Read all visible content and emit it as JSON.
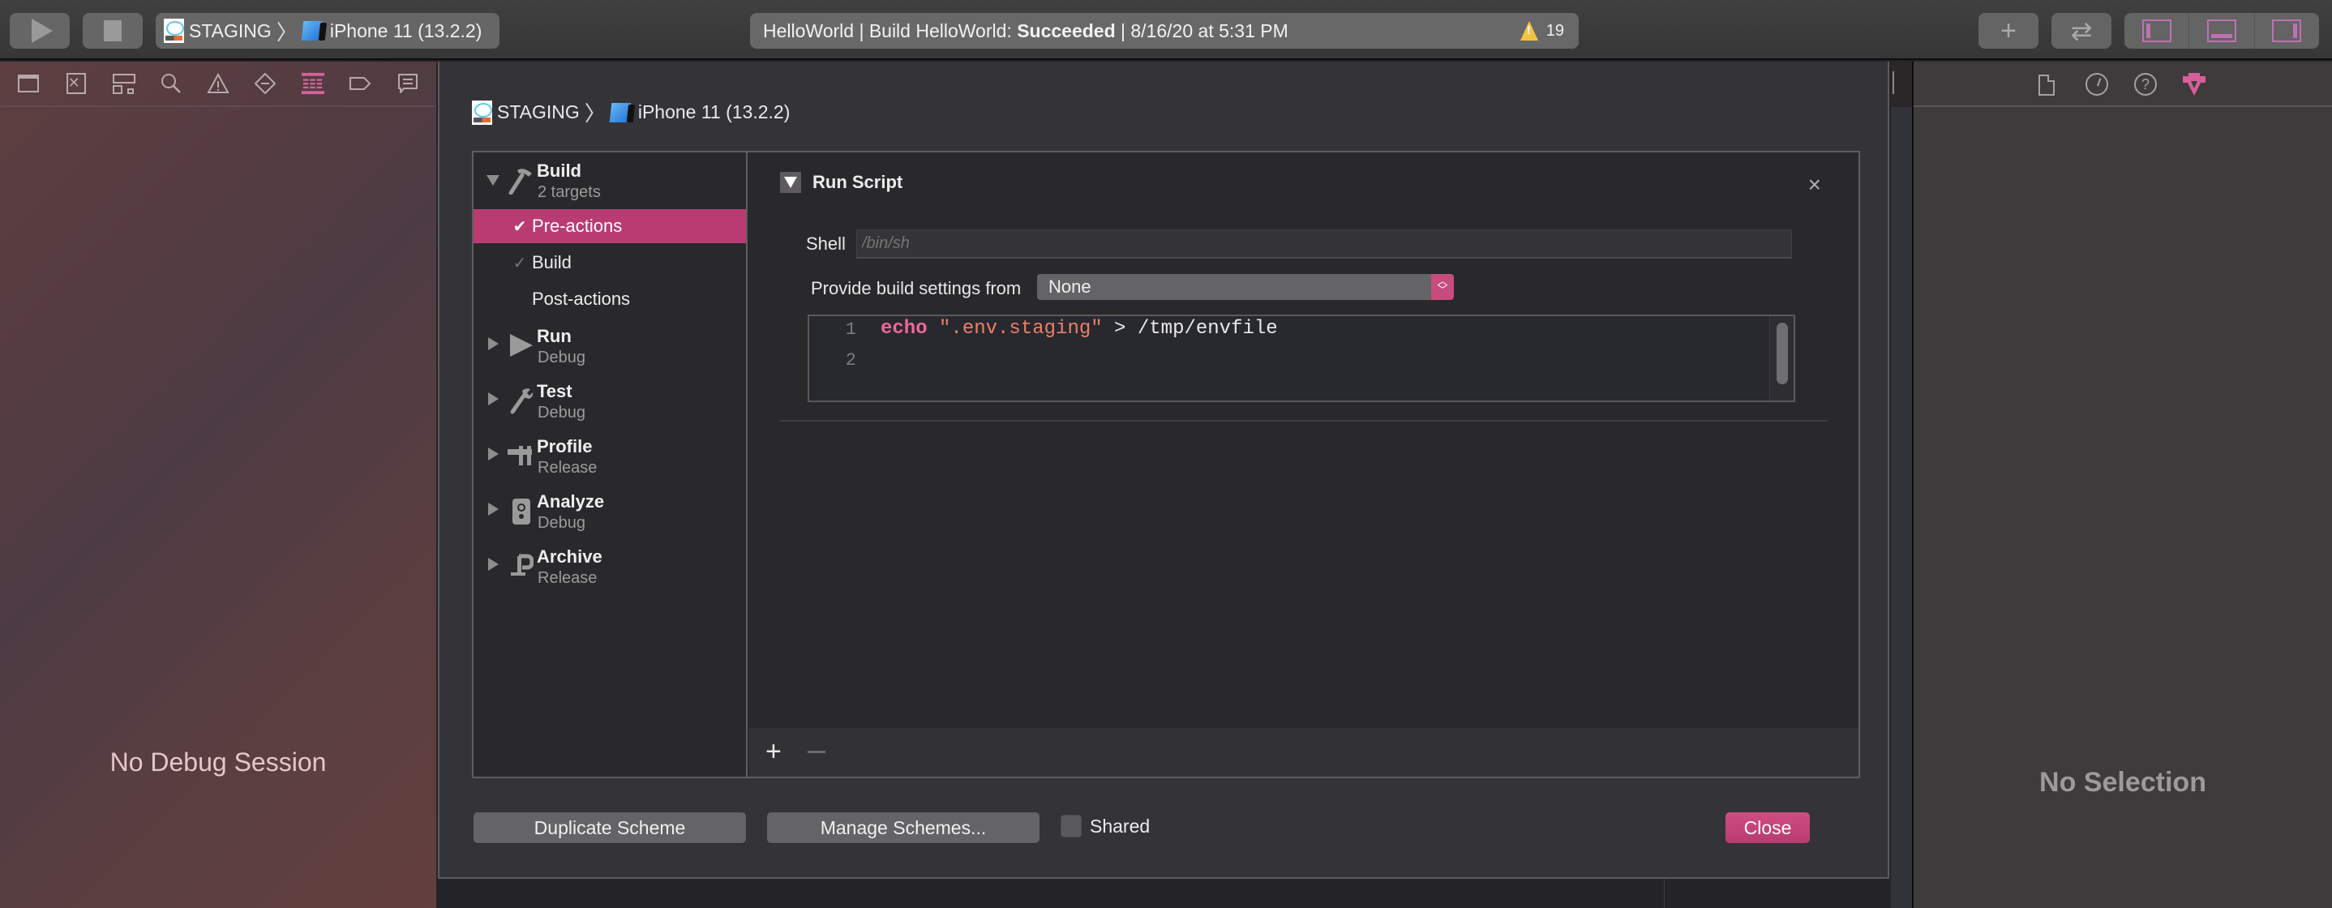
{
  "toolbar": {
    "run_button": "run",
    "stop_button": "stop",
    "scheme": {
      "name": "STAGING",
      "separator": "〉",
      "destination": "iPhone 11 (13.2.2)"
    },
    "status": {
      "prefix": "HelloWorld | Build HelloWorld: ",
      "result": "Succeeded",
      "suffix": " | 8/16/20 at 5:31 PM",
      "warning_count": "19"
    },
    "add_icon": "+",
    "swap_icon": "⇄",
    "panel_toggles": [
      "navigator",
      "debug-area",
      "inspector"
    ],
    "accent_color": "#c071b2"
  },
  "navigator": {
    "icons": [
      "folder-icon",
      "source-control-icon",
      "hierarchy-icon",
      "search-icon",
      "warning-icon",
      "test-icon",
      "debug-icon",
      "breakpoint-icon",
      "report-icon"
    ],
    "active_icon": "debug-icon",
    "empty_message": "No Debug Session"
  },
  "sheet": {
    "breadcrumb": {
      "scheme": "STAGING",
      "separator": "〉",
      "destination": "iPhone 11 (13.2.2)"
    },
    "sidebar": {
      "groups": [
        {
          "name": "Build",
          "subtitle": "2 targets",
          "expanded": true,
          "icon": "hammer-icon",
          "actions": [
            {
              "label": "Pre-actions",
              "checked": true,
              "selected": true
            },
            {
              "label": "Build",
              "checked": true,
              "selected": false
            },
            {
              "label": "Post-actions",
              "checked": false,
              "selected": false
            }
          ]
        },
        {
          "name": "Run",
          "subtitle": "Debug",
          "expanded": false,
          "icon": "play-icon"
        },
        {
          "name": "Test",
          "subtitle": "Debug",
          "expanded": false,
          "icon": "wrench-icon"
        },
        {
          "name": "Profile",
          "subtitle": "Release",
          "expanded": false,
          "icon": "caliper-icon"
        },
        {
          "name": "Analyze",
          "subtitle": "Debug",
          "expanded": false,
          "icon": "analyze-icon"
        },
        {
          "name": "Archive",
          "subtitle": "Release",
          "expanded": false,
          "icon": "archive-icon"
        }
      ]
    },
    "run_script": {
      "title": "Run Script",
      "close_glyph": "×",
      "shell_label": "Shell",
      "shell_placeholder": "/bin/sh",
      "shell_value": "",
      "build_settings_label": "Provide build settings from",
      "build_settings_value": "None",
      "code_lines": [
        {
          "number": "1",
          "keyword": "echo",
          "string": "\".env.staging\"",
          "rest": " > /tmp/envfile"
        },
        {
          "number": "2",
          "keyword": "",
          "string": "",
          "rest": ""
        }
      ]
    },
    "footer": {
      "add_glyph": "+",
      "remove_glyph": "−"
    },
    "buttons": {
      "duplicate": "Duplicate Scheme",
      "manage": "Manage Schemes...",
      "shared_label": "Shared",
      "shared_checked": false,
      "close": "Close"
    },
    "accent_color": "#b83c72"
  },
  "inspector": {
    "icons": [
      "file-icon",
      "history-icon",
      "help-icon",
      "attributes-icon"
    ],
    "active_icon": "attributes-icon",
    "empty_message": "No Selection"
  }
}
